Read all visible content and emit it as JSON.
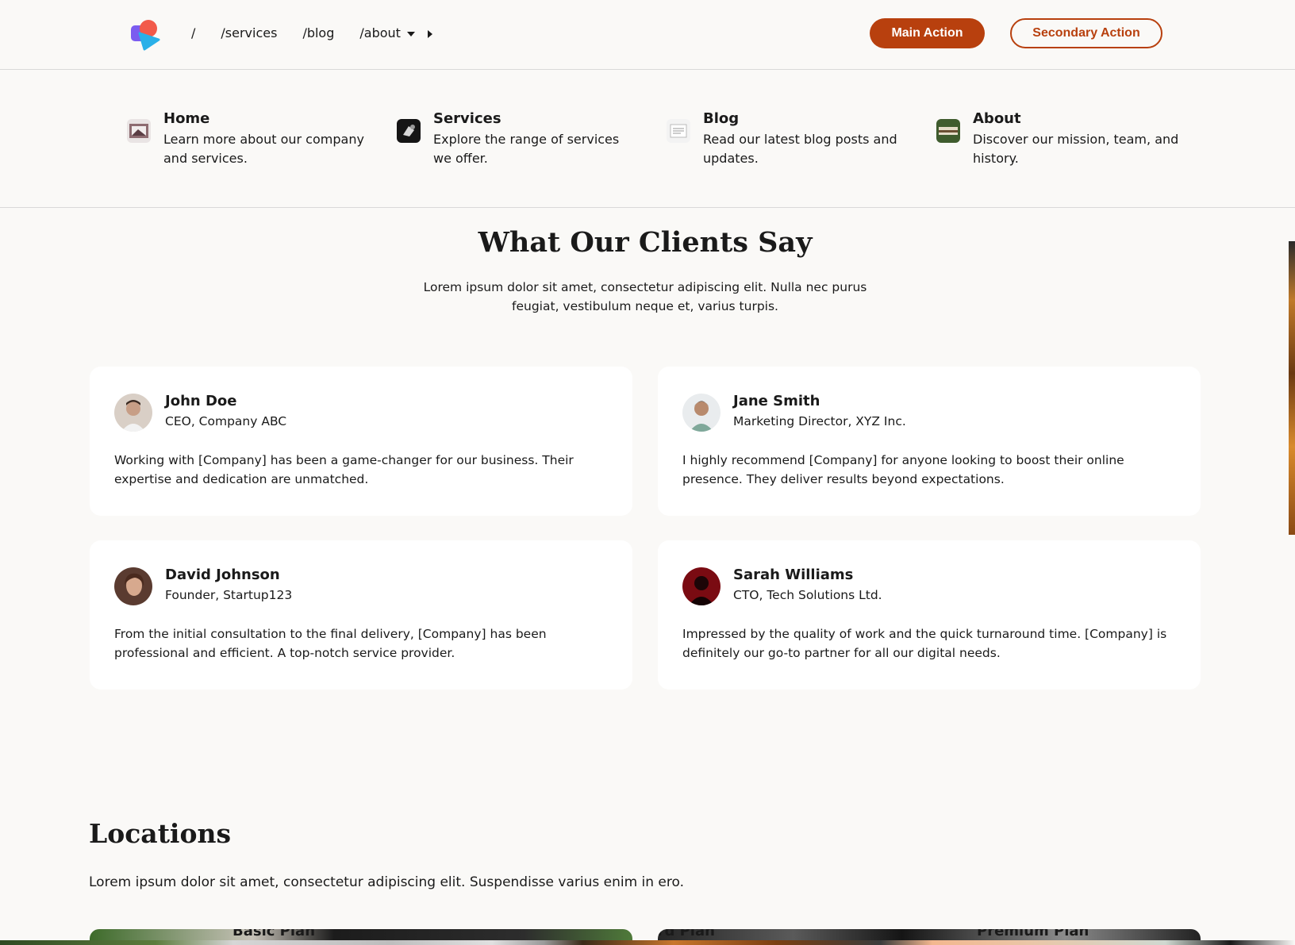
{
  "nav": {
    "links": [
      "/",
      "/services",
      "/blog",
      "/about"
    ],
    "main_action": "Main Action",
    "secondary_action": "Secondary Action"
  },
  "mega_menu": [
    {
      "title": "Home",
      "description": "Learn more about our company and services."
    },
    {
      "title": "Services",
      "description": "Explore the range of services we offer."
    },
    {
      "title": "Blog",
      "description": "Read our latest blog posts and updates."
    },
    {
      "title": "About",
      "description": "Discover our mission, team, and history."
    }
  ],
  "testimonials": {
    "title": "What Our Clients Say",
    "subtitle": "Lorem ipsum dolor sit amet, consectetur adipiscing elit. Nulla nec purus feugiat, vestibulum neque et, varius turpis.",
    "items": [
      {
        "name": "John Doe",
        "role": "CEO, Company ABC",
        "quote": "Working with [Company] has been a game-changer for our business. Their expertise and dedication are unmatched."
      },
      {
        "name": "Jane Smith",
        "role": "Marketing Director, XYZ Inc.",
        "quote": "I highly recommend [Company] for anyone looking to boost their online presence. They deliver results beyond expectations."
      },
      {
        "name": "David Johnson",
        "role": "Founder, Startup123",
        "quote": "From the initial consultation to the final delivery, [Company] has been professional and efficient. A top-notch service provider."
      },
      {
        "name": "Sarah Williams",
        "role": "CTO, Tech Solutions Ltd.",
        "quote": "Impressed by the quality of work and the quick turnaround time. [Company] is definitely our go-to partner for all our digital needs."
      }
    ]
  },
  "locations": {
    "title": "Locations",
    "subtitle": "Lorem ipsum dolor sit amet, consectetur adipiscing elit. Suspendisse varius enim in ero."
  },
  "plans_peek": [
    "Basic Plan",
    "Standard Plan",
    "Premium Plan"
  ],
  "colors": {
    "accent": "#b8400e",
    "background": "#faf9f7",
    "card": "#ffffff"
  },
  "icons": [
    "logo-icon",
    "chevron-down-icon",
    "chevron-right-icon"
  ]
}
